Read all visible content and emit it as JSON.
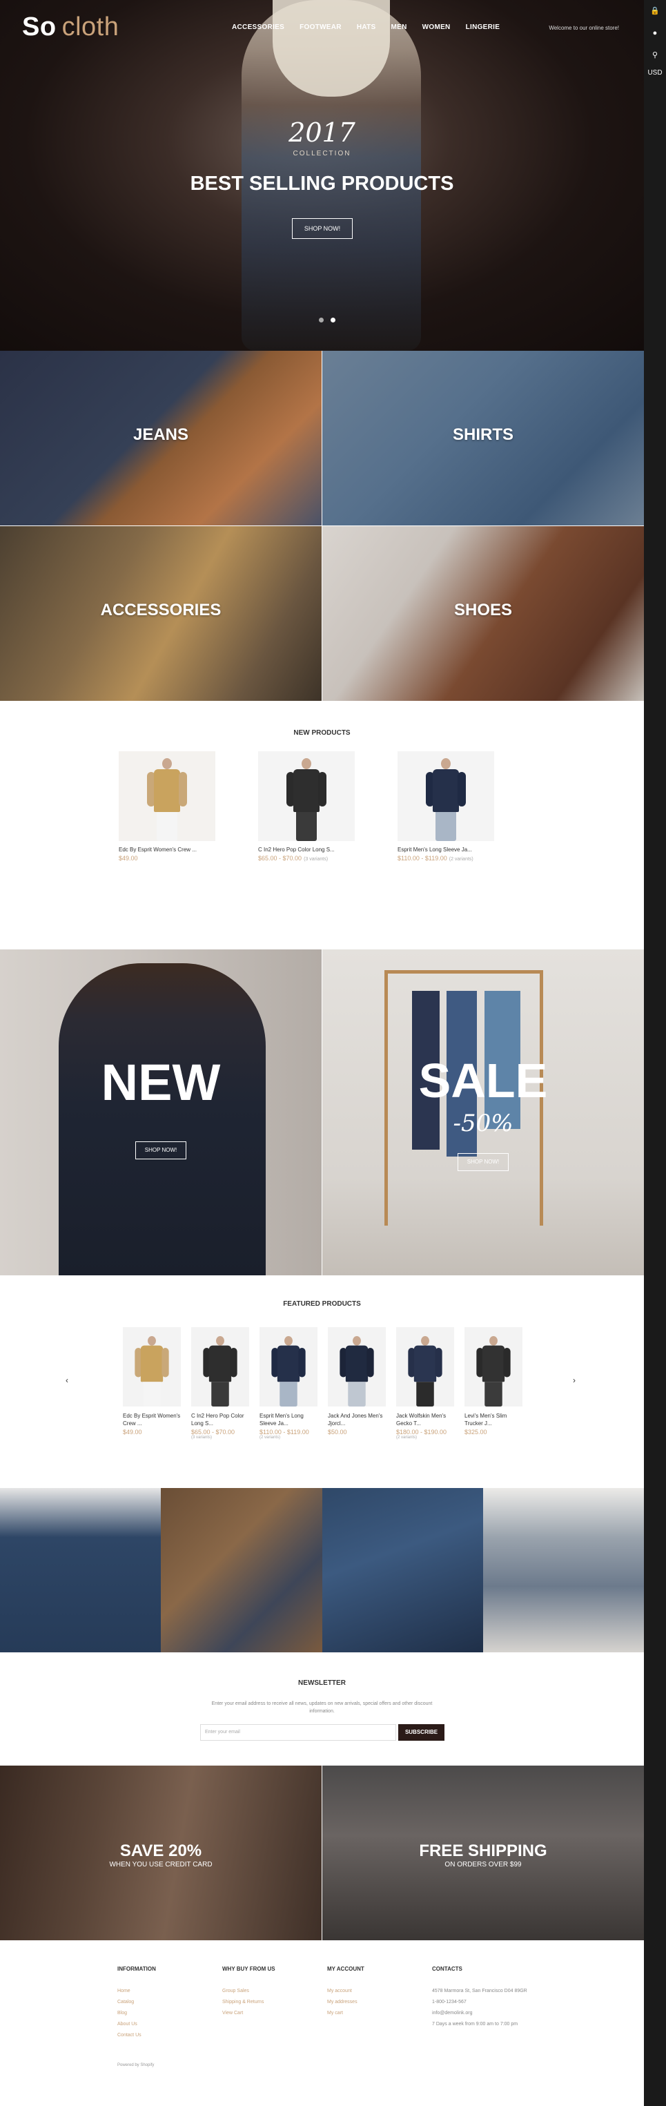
{
  "logo": {
    "word1": "So",
    "word2": "cloth"
  },
  "nav": [
    "ACCESSORIES",
    "FOOTWEAR",
    "HATS",
    "MEN",
    "WOMEN",
    "LINGERIE"
  ],
  "welcome": "Welcome to our online store!",
  "currency": "USD",
  "hero": {
    "year": "2017",
    "collection": "COLLECTION",
    "title": "BEST SELLING PRODUCTS",
    "button": "SHOP NOW!"
  },
  "categories": [
    "JEANS",
    "SHIRTS",
    "ACCESSORIES",
    "SHOES"
  ],
  "new_products": {
    "title": "NEW PRODUCTS",
    "items": [
      {
        "name": "Edc By Esprit Women's Crew ...",
        "price": "$49.00",
        "variants": ""
      },
      {
        "name": "C In2 Hero Pop Color Long S...",
        "price": "$65.00 - $70.00",
        "variants": "(3 variants)"
      },
      {
        "name": "Esprit Men's Long Sleeve Ja...",
        "price": "$110.00 - $119.00",
        "variants": "(2 variants)"
      }
    ]
  },
  "promo": {
    "new": "NEW",
    "sale": "SALE",
    "sale_off": "-50%",
    "button": "SHOP NOW!"
  },
  "featured": {
    "title": "FEATURED PRODUCTS",
    "items": [
      {
        "name": "Edc By Esprit Women's Crew ...",
        "price": "$49.00",
        "variants": ""
      },
      {
        "name": "C In2 Hero Pop Color Long S...",
        "price": "$65.00 - $70.00",
        "variants": "(3 variants)"
      },
      {
        "name": "Esprit Men's Long Sleeve Ja...",
        "price": "$110.00 - $119.00",
        "variants": "(2 variants)"
      },
      {
        "name": "Jack And Jones Men's Jjorcl...",
        "price": "$50.00",
        "variants": ""
      },
      {
        "name": "Jack Wolfskin Men's Gecko T...",
        "price": "$180.00 - $190.00",
        "variants": "(2 variants)"
      },
      {
        "name": "Levi's Men's Slim Trucker J...",
        "price": "$325.00",
        "variants": ""
      }
    ]
  },
  "newsletter": {
    "title": "NEWSLETTER",
    "text": "Enter your email address to receive all news, updates on new arrivals, special offers and other discount information.",
    "placeholder": "Enter your email",
    "button": "SUBSCRIBE"
  },
  "bottom_promos": [
    {
      "title": "SAVE 20%",
      "sub": "WHEN YOU USE CREDIT CARD"
    },
    {
      "title": "FREE SHIPPING",
      "sub": "ON ORDERS OVER $99"
    }
  ],
  "footer": {
    "information": {
      "title": "INFORMATION",
      "items": [
        "Home",
        "Catalog",
        "Blog",
        "About Us",
        "Contact Us"
      ]
    },
    "why": {
      "title": "WHY BUY FROM US",
      "items": [
        "Group Sales",
        "Shipping & Returns",
        "View Cart"
      ]
    },
    "account": {
      "title": "MY ACCOUNT",
      "items": [
        "My account",
        "My addresses",
        "My cart"
      ]
    },
    "contacts": {
      "title": "CONTACTS",
      "items": [
        "4578 Marmora St, San Francisco D04 89GR",
        "1-800-1234-567",
        "info@demolink.org",
        "7 Days a week from 9:00 am to 7:00 pm"
      ]
    },
    "powered": "Powered by Shopify"
  },
  "colors": {
    "accent": "#c9a27a",
    "dark": "#1a1a1a"
  }
}
